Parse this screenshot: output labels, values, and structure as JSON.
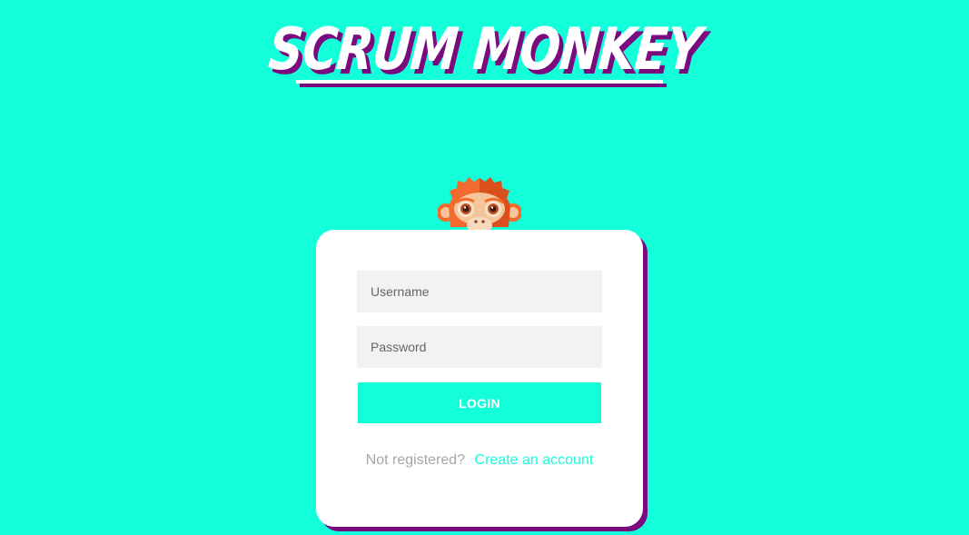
{
  "header": {
    "title": "SCRUM MONKEY"
  },
  "login_form": {
    "username_placeholder": "Username",
    "password_placeholder": "Password",
    "login_label": "LOGIN",
    "not_registered_text": "Not registered?",
    "create_account_link": "Create an account"
  },
  "colors": {
    "background": "#13ffd9",
    "accent_shadow": "#7a0a7e",
    "card": "#ffffff",
    "input_bg": "#f2f2f2",
    "monkey_orange": "#f26a2e"
  },
  "icons": {
    "mascot": "monkey-mascot-icon"
  }
}
